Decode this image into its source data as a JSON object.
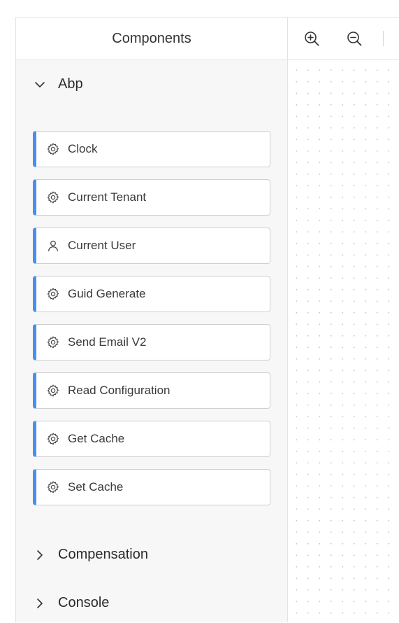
{
  "panel": {
    "title": "Components"
  },
  "groups": [
    {
      "label": "Abp",
      "expanded": true,
      "chevron": "chevron-down-icon"
    },
    {
      "label": "Compensation",
      "expanded": false,
      "chevron": "chevron-right-icon"
    },
    {
      "label": "Console",
      "expanded": false,
      "chevron": "chevron-right-icon"
    }
  ],
  "items": [
    {
      "label": "Clock",
      "icon": "gear-icon"
    },
    {
      "label": "Current Tenant",
      "icon": "gear-icon"
    },
    {
      "label": "Current User",
      "icon": "user-icon"
    },
    {
      "label": "Guid Generate",
      "icon": "gear-icon"
    },
    {
      "label": "Send Email V2",
      "icon": "gear-icon"
    },
    {
      "label": "Read Configuration",
      "icon": "gear-icon"
    },
    {
      "label": "Get Cache",
      "icon": "gear-icon"
    },
    {
      "label": "Set Cache",
      "icon": "gear-icon"
    }
  ],
  "toolbar": {
    "zoom_in_icon": "zoom-in-icon",
    "zoom_out_icon": "zoom-out-icon"
  },
  "colors": {
    "accent": "#4a8ef0",
    "panel_bg": "#f7f7f7",
    "border": "#cfcfcf"
  }
}
